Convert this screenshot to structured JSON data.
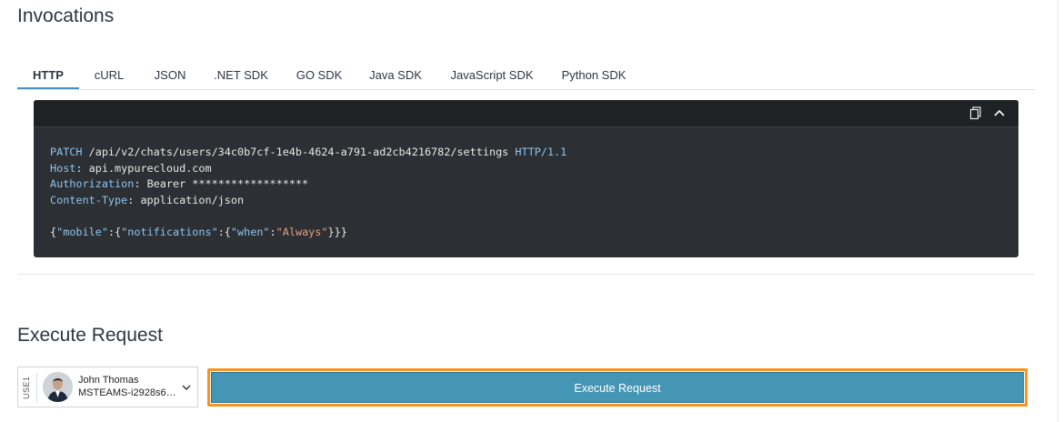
{
  "invocations": {
    "title": "Invocations",
    "tabs": [
      {
        "label": "HTTP",
        "active": true
      },
      {
        "label": "cURL"
      },
      {
        "label": "JSON"
      },
      {
        "label": ".NET SDK"
      },
      {
        "label": "GO SDK"
      },
      {
        "label": "Java SDK"
      },
      {
        "label": "JavaScript SDK"
      },
      {
        "label": "Python SDK"
      }
    ],
    "toolbar_icons": [
      "copy-icon",
      "chevron-up-icon"
    ],
    "code": {
      "method": "PATCH",
      "path": "/api/v2/chats/users/34c0b7cf-1e4b-4624-a791-ad2cb4216782/settings",
      "protocol": "HTTP/1.1",
      "host_key": "Host",
      "host_value": "api.mypurecloud.com",
      "auth_key": "Authorization",
      "auth_value": "Bearer ******************",
      "ctype_key": "Content-Type",
      "ctype_value": "application/json",
      "body_open1": "{",
      "body_key1": "\"mobile\"",
      "body_colon1": ":{",
      "body_key2": "\"notifications\"",
      "body_colon2": ":{",
      "body_key3": "\"when\"",
      "body_colon3": ":",
      "body_value": "\"Always\"",
      "body_close": "}}}"
    }
  },
  "execute": {
    "title": "Execute Request",
    "env_label": "USE1",
    "user_name": "John Thomas",
    "user_id": "MSTEAMS-i2928s6v...",
    "button_label": "Execute Request"
  },
  "colors": {
    "code_bg": "#2c2f33",
    "code_key": "#8fc4ef",
    "code_string": "#e0a184",
    "button_bg": "#4596b5",
    "button_outline": "#f7941d",
    "tab_active": "#4a90c2"
  }
}
